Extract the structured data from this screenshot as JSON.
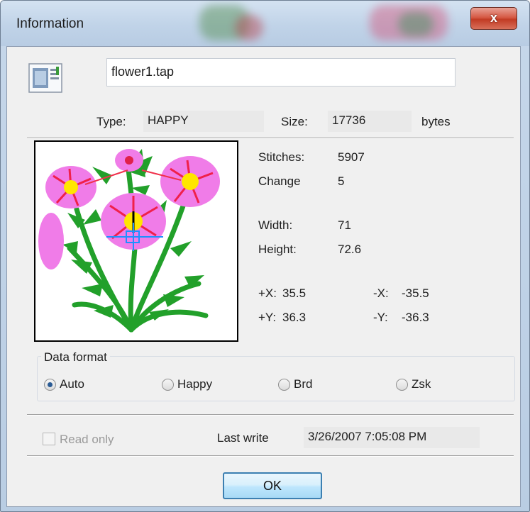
{
  "window": {
    "title": "Information",
    "close_label": "x"
  },
  "file": {
    "name": "flower1.tap"
  },
  "type": {
    "label": "Type:",
    "value": "HAPPY"
  },
  "size": {
    "label": "Size:",
    "value": "17736",
    "unit": "bytes"
  },
  "stats": {
    "stitches_label": "Stitches:",
    "stitches_value": "5907",
    "change_label": "Change",
    "change_value": "5",
    "width_label": "Width:",
    "width_value": "71",
    "height_label": "Height:",
    "height_value": "72.6",
    "plus_x_label": "+X:",
    "plus_x_value": "35.5",
    "minus_x_label": "-X:",
    "minus_x_value": "-35.5",
    "plus_y_label": "+Y:",
    "plus_y_value": "36.3",
    "minus_y_label": "-Y:",
    "minus_y_value": "-36.3"
  },
  "data_format": {
    "legend": "Data format",
    "options": [
      "Auto",
      "Happy",
      "Brd",
      "Zsk"
    ],
    "selected": "Auto"
  },
  "read_only": {
    "label": "Read only",
    "checked": false,
    "enabled": false
  },
  "last_write": {
    "label": "Last write",
    "value": "3/26/2007 7:05:08 PM"
  },
  "ok_button": {
    "label": "OK"
  },
  "colors": {
    "accent": "#3c7fb1",
    "close_red": "#c23b24",
    "petal_pink": "#f07ce8",
    "stem_green": "#22a02a",
    "center_yellow": "#ffe600"
  }
}
